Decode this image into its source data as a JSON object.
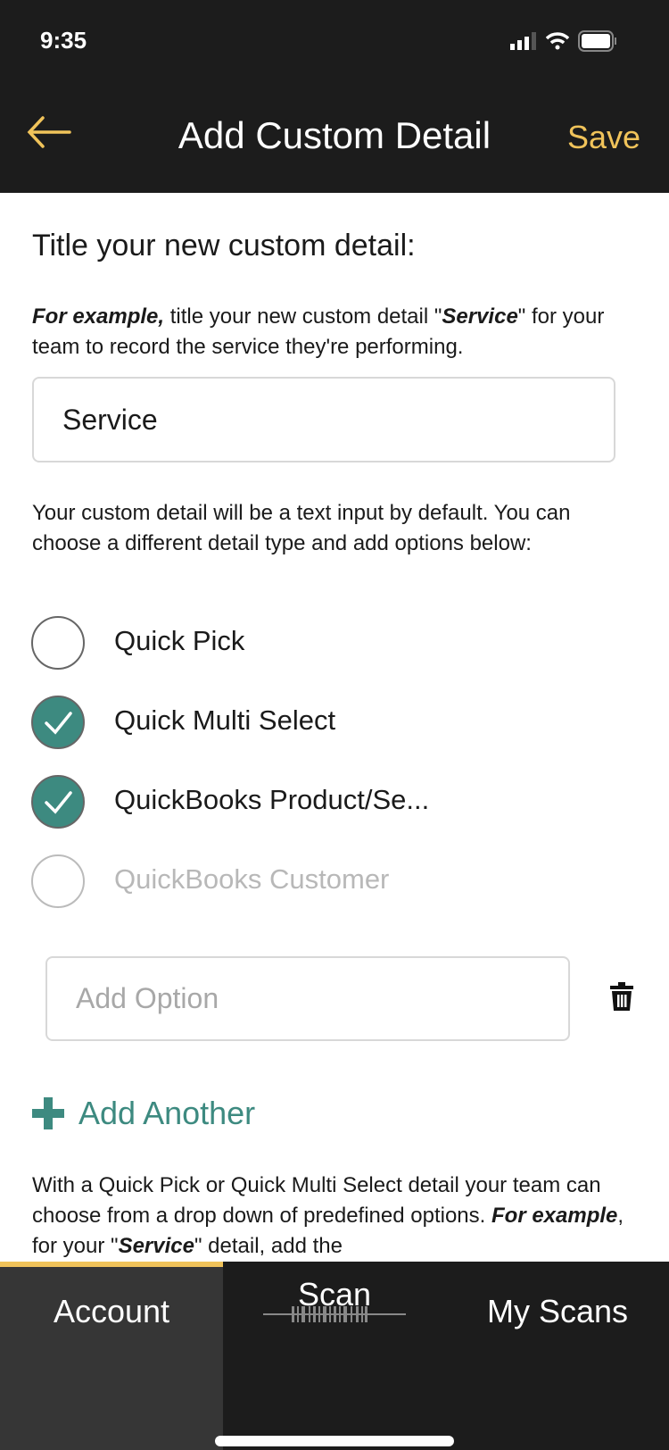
{
  "status": {
    "time": "9:35"
  },
  "header": {
    "title": "Add Custom Detail",
    "save_label": "Save",
    "back_icon": "arrow-left-icon"
  },
  "colors": {
    "accent": "#f0c35a",
    "teal": "#3d8a80",
    "header": "#1c1c1c"
  },
  "form": {
    "heading": "Title your new custom detail:",
    "example_bold": "For example,",
    "example_text1": " title your new custom detail \"",
    "example_service": "Service",
    "example_text2": "\" for your team to record the service they're performing.",
    "title_value": "Service",
    "type_help": "Your custom detail will be a text input by default. You can choose a different detail type and add options below:",
    "types": [
      {
        "label": "Quick Pick",
        "checked": false,
        "disabled": false
      },
      {
        "label": "Quick Multi Select",
        "checked": true,
        "disabled": false
      },
      {
        "label": "QuickBooks Product/Se...",
        "checked": true,
        "disabled": false
      },
      {
        "label": "QuickBooks Customer",
        "checked": false,
        "disabled": true
      }
    ],
    "option_placeholder": "Add Option",
    "add_another": "Add Another",
    "footer_1": "With a Quick Pick or Quick Multi Select detail your team can choose from a drop down of predefined options. ",
    "footer_bold": "For example",
    "footer_2": ", for your \"",
    "footer_service": "Service",
    "footer_3": "\" detail, add the"
  },
  "tabs": [
    {
      "label": "Account",
      "active": true
    },
    {
      "label": "Scan"
    },
    {
      "label": "My Scans"
    }
  ]
}
